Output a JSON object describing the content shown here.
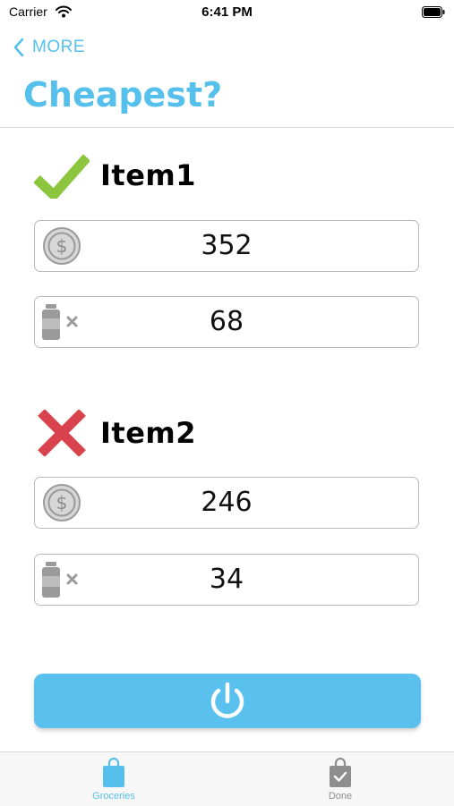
{
  "status_bar": {
    "carrier": "Carrier",
    "time": "6:41 PM"
  },
  "nav": {
    "back_label": "MORE",
    "title": "Cheapest?"
  },
  "items": [
    {
      "name": "Item1",
      "status": "check-icon",
      "price": "352",
      "quantity": "68"
    },
    {
      "name": "Item2",
      "status": "cross-icon",
      "price": "246",
      "quantity": "34"
    }
  ],
  "tabs": [
    {
      "label": "Groceries",
      "icon": "shopping-bag-icon",
      "active": true
    },
    {
      "label": "Done",
      "icon": "checked-bag-icon",
      "active": false
    }
  ],
  "colors": {
    "accent": "#55c0ec",
    "check": "#8cc63f",
    "cross": "#d9434e",
    "inactive": "#8e8e8e"
  }
}
